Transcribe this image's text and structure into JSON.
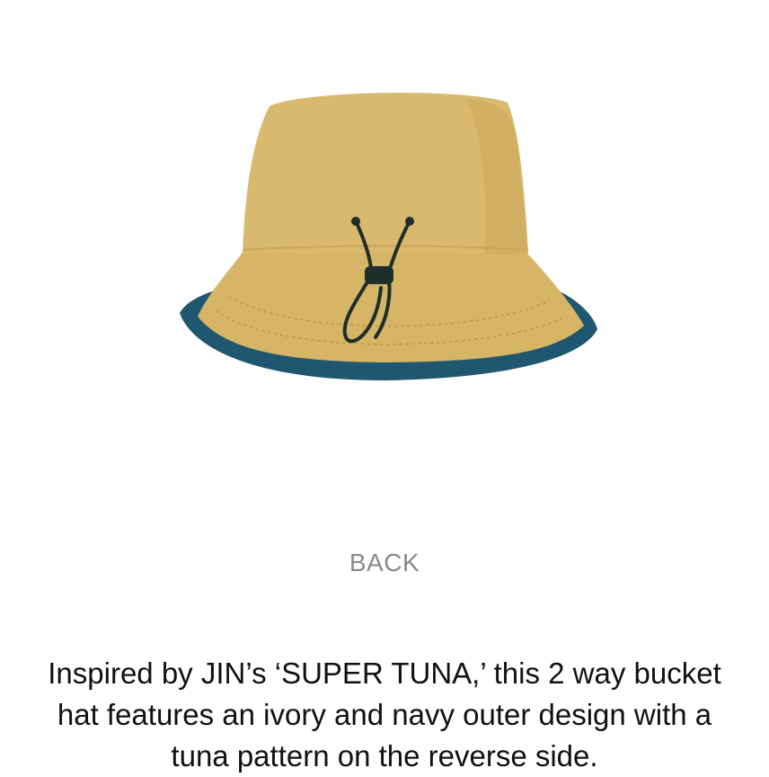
{
  "product": {
    "image": {
      "icon": "bucket-hat",
      "colors": {
        "crown": "#d9b96e",
        "crown_shade": "#c9a65a",
        "brim": "#d6b566",
        "brim_trim": "#1f5670",
        "drawcord": "#1e2e2a",
        "stitch": "#b8974e"
      }
    },
    "view_label": "BACK",
    "description": "Inspired by JIN’s ‘SUPER TUNA,’ this 2 way bucket hat features an ivory and navy outer design with a tuna pattern on the reverse side."
  }
}
